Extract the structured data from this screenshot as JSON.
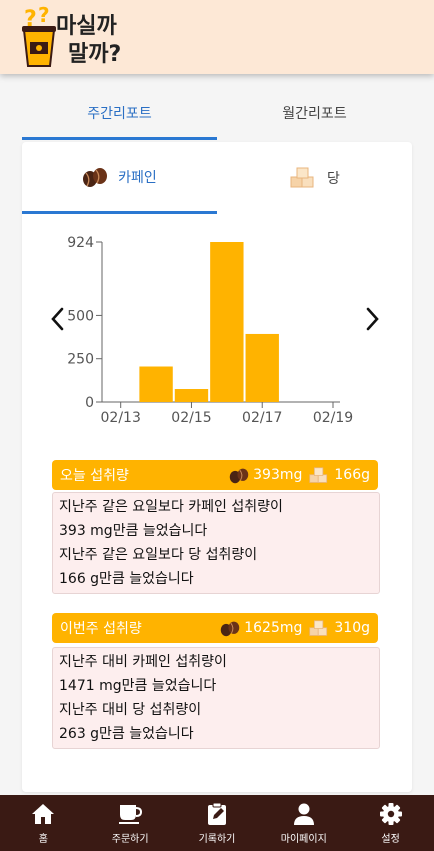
{
  "header": {
    "logo_line1": "마실까",
    "logo_line2": "말까?"
  },
  "report_tabs": [
    {
      "label": "주간리포트",
      "active": true
    },
    {
      "label": "월간리포트",
      "active": false
    }
  ],
  "sub_tabs": [
    {
      "label": "카페인",
      "icon": "coffee-bean-icon",
      "active": true
    },
    {
      "label": "당",
      "icon": "sugar-cube-icon",
      "active": false
    }
  ],
  "chart_data": {
    "type": "bar",
    "categories": [
      "02/13",
      "02/14",
      "02/15",
      "02/16",
      "02/17",
      "02/18",
      "02/19"
    ],
    "values": [
      0,
      205,
      75,
      924,
      393,
      0,
      0
    ],
    "y_ticks": [
      "0",
      "250",
      "500",
      "924"
    ],
    "x_tick_labels": [
      "02/13",
      "02/15",
      "02/17",
      "02/19"
    ],
    "ylim": [
      0,
      924
    ],
    "bar_color": "#ffb300",
    "grid": false
  },
  "today": {
    "title": "오늘 섭취량",
    "caffeine": "393mg",
    "sugar": "166g",
    "lines": [
      "지난주 같은 요일보다 카페인 섭취량이",
      "393 mg만큼 늘었습니다",
      "지난주 같은 요일보다 당 섭취량이",
      "166 g만큼 늘었습니다"
    ]
  },
  "week": {
    "title": "이번주 섭취량",
    "caffeine": "1625mg",
    "sugar": "310g",
    "lines": [
      "지난주 대비 카페인 섭취량이",
      "1471 mg만큼 늘었습니다",
      "지난주 대비 당 섭취량이",
      "263 g만큼 늘었습니다"
    ]
  },
  "nav": [
    {
      "label": "홈",
      "icon": "home-icon"
    },
    {
      "label": "주문하기",
      "icon": "coffee-cup-icon"
    },
    {
      "label": "기록하기",
      "icon": "clipboard-edit-icon"
    },
    {
      "label": "마이페이지",
      "icon": "person-icon"
    },
    {
      "label": "설정",
      "icon": "gear-icon"
    }
  ],
  "colors": {
    "accent": "#2a78d2",
    "amber": "#ffb300",
    "nav_bg": "#3a1a14",
    "header_bg": "#fde8d6"
  }
}
